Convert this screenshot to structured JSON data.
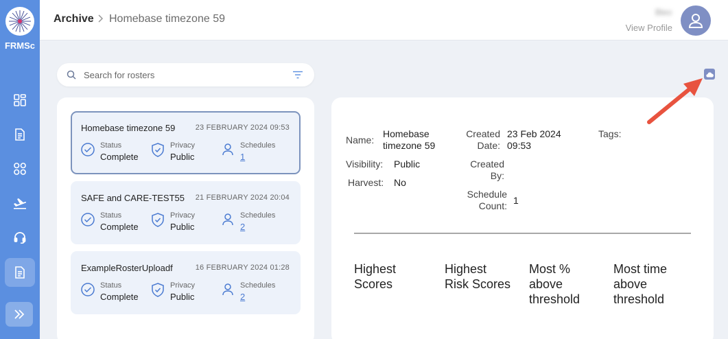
{
  "app": {
    "brand": "FRMSc",
    "logo_icon": "dandelion-logo-icon",
    "accent": "#5b8fe0"
  },
  "sidebar": {
    "items": [
      {
        "name": "dashboard",
        "icon": "grid-icon"
      },
      {
        "name": "reports",
        "icon": "document-icon"
      },
      {
        "name": "modules",
        "icon": "apps-icon"
      },
      {
        "name": "flights",
        "icon": "airplane-icon"
      },
      {
        "name": "support",
        "icon": "headset-icon"
      },
      {
        "name": "archive",
        "icon": "document-icon",
        "active": true
      }
    ],
    "expand_icon": "double-chevron-right-icon"
  },
  "header": {
    "breadcrumb_root": "Archive",
    "breadcrumb_separator": ">",
    "breadcrumb_current": "Homebase timezone 59",
    "user_name": "Bleo",
    "view_profile": "View Profile"
  },
  "search": {
    "placeholder": "Search for rosters",
    "value": ""
  },
  "rosters": [
    {
      "title": "Homebase timezone 59",
      "date": "23 FEBRUARY 2024 09:53",
      "status_label": "Status",
      "status": "Complete",
      "privacy_label": "Privacy",
      "privacy": "Public",
      "schedules_label": "Schedules",
      "schedules": "1",
      "selected": true
    },
    {
      "title": "SAFE and CARE-TEST55",
      "date": "21 FEBRUARY 2024 20:04",
      "status_label": "Status",
      "status": "Complete",
      "privacy_label": "Privacy",
      "privacy": "Public",
      "schedules_label": "Schedules",
      "schedules": "2",
      "selected": false
    },
    {
      "title": "ExampleRosterUploadf",
      "date": "16 FEBRUARY 2024 01:28",
      "status_label": "Status",
      "status": "Complete",
      "privacy_label": "Privacy",
      "privacy": "Public",
      "schedules_label": "Schedules",
      "schedules": "2",
      "selected": false
    }
  ],
  "detail": {
    "name_label": "Name:",
    "name_line1": "Homebase",
    "name_line2": "timezone 59",
    "visibility_label": "Visibility:",
    "visibility": "Public",
    "harvest_label": "Harvest:",
    "harvest": "No",
    "created_date_label_1": "Created",
    "created_date_label_2": "Date:",
    "created_date_1": "23 Feb 2024",
    "created_date_2": "09:53",
    "created_by_label_1": "Created",
    "created_by_label_2": "By:",
    "created_by": "",
    "schedule_count_label_1": "Schedule",
    "schedule_count_label_2": "Count:",
    "schedule_count": "1",
    "tags_label": "Tags:",
    "score_headings": [
      {
        "line1": "Highest",
        "line2": "Scores",
        "line3": ""
      },
      {
        "line1": "Highest",
        "line2": "Risk Scores",
        "line3": ""
      },
      {
        "line1": "Most %",
        "line2": "above",
        "line3": "threshold"
      },
      {
        "line1": "Most time",
        "line2": "above",
        "line3": "threshold"
      }
    ]
  },
  "toolbar": {
    "upload_icon": "cloud-upload-icon"
  },
  "annotation": {
    "arrow_color": "#e8533f"
  }
}
